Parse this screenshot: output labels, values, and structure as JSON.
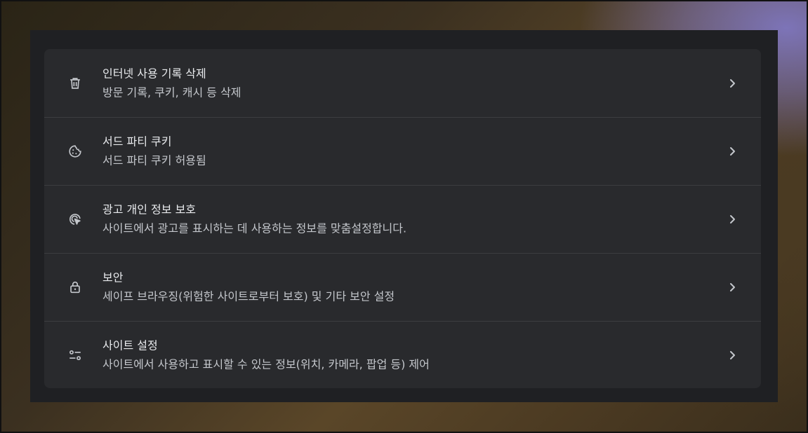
{
  "colors": {
    "panel_bg": "#1f2023",
    "card_bg": "#292a2d",
    "divider": "#3c3d40",
    "title_text": "#e8eaed",
    "subtitle_text": "#c4c7cc",
    "icon": "#c4c7cc"
  },
  "settings": {
    "items": [
      {
        "icon": "trash-icon",
        "title": "인터넷 사용 기록 삭제",
        "subtitle": "방문 기록, 쿠키, 캐시 등 삭제"
      },
      {
        "icon": "cookie-icon",
        "title": "서드 파티 쿠키",
        "subtitle": "서드 파티 쿠키 허용됨"
      },
      {
        "icon": "ad-privacy-icon",
        "title": "광고 개인 정보 보호",
        "subtitle": "사이트에서 광고를 표시하는 데 사용하는 정보를 맞춤설정합니다."
      },
      {
        "icon": "lock-icon",
        "title": "보안",
        "subtitle": "세이프 브라우징(위험한 사이트로부터 보호) 및 기타 보안 설정"
      },
      {
        "icon": "tune-icon",
        "title": "사이트 설정",
        "subtitle": "사이트에서 사용하고 표시할 수 있는 정보(위치, 카메라, 팝업 등) 제어"
      }
    ]
  }
}
